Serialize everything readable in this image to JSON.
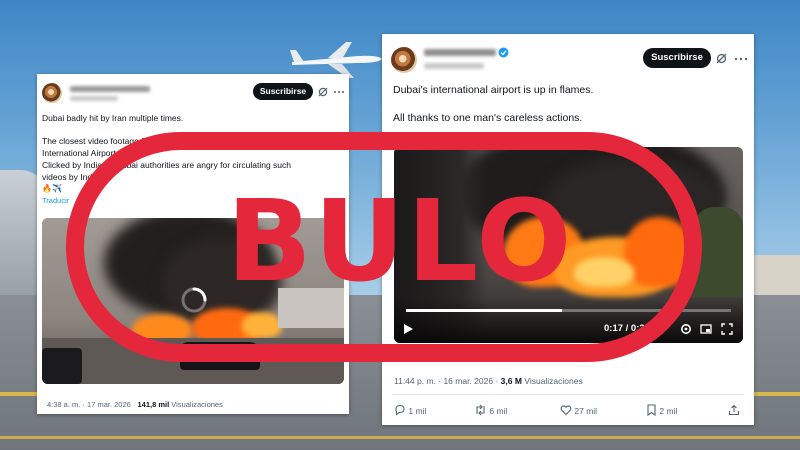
{
  "left_post": {
    "subscribe_label": "Suscribirse",
    "body_line1": "Dubai badly hit by Iran multiple times.",
    "body_line2": "The closest video footage from the site of the burning fuel tanks at Dubai",
    "body_line3": "International Airport (DXB).",
    "body_line4": "Clicked by Indians, Dubai authorities are angry for circulating such",
    "body_line5": "videos by Indians.",
    "emoji_line": "🔥✈️",
    "translate_link": "Traducir",
    "timestamp": "4:38 a. m. · 17 mar. 2026",
    "views_count": "141,8 mil",
    "views_label": "Visualizaciones"
  },
  "right_post": {
    "subscribe_label": "Suscribirse",
    "body_line1": "Dubai's international airport is up in flames.",
    "body_line2": "All thanks to one man's careless actions.",
    "video_time": "0:17 / 0:3",
    "timestamp": "11:44 p. m. · 16 mar. 2026",
    "views_count": "3,6 M",
    "views_label": "Visualizaciones",
    "replies": "1 mil",
    "reposts": "6 mil",
    "likes": "27 mil",
    "bookmarks": "2 mil"
  },
  "stamp": {
    "text": "BULO",
    "color": "#e5273b"
  },
  "icons": [
    "grok-icon",
    "play-icon",
    "volume-icon",
    "settings-icon",
    "pip-icon",
    "fullscreen-icon",
    "reply-icon",
    "repost-icon",
    "like-icon",
    "bookmark-icon",
    "share-icon",
    "loading-spinner-icon",
    "verified-badge-icon"
  ]
}
